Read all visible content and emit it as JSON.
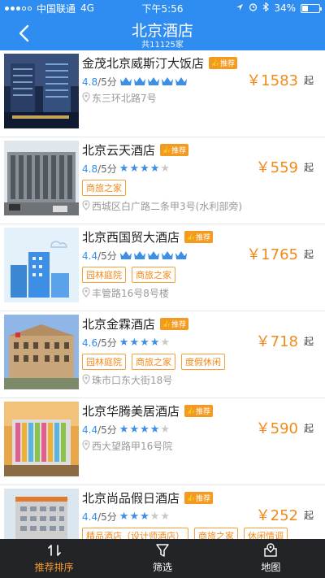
{
  "status": {
    "carrier": "中国联通",
    "network": "4G",
    "time": "下午5:56",
    "battery": "34%"
  },
  "header": {
    "title": "北京酒店",
    "subtitle": "共11125家"
  },
  "common": {
    "recommend_badge": "推荐",
    "score_unit": "/5分",
    "price_suffix": "起"
  },
  "hotels": [
    {
      "name": "金茂北京威斯汀大饭店",
      "score": "4.8",
      "stars": 5,
      "rating_type": "crown",
      "tags": [],
      "address": "东三环北路7号",
      "price": "￥1583"
    },
    {
      "name": "北京云天酒店",
      "score": "4.8",
      "stars": 4,
      "rating_type": "star",
      "tags": [
        "商旅之家"
      ],
      "address": "西城区白广路二条甲3号(水利部旁)",
      "price": "￥559"
    },
    {
      "name": "北京西国贸大酒店",
      "score": "4.4",
      "stars": 5,
      "rating_type": "crown",
      "tags": [
        "园林庭院",
        "商旅之家"
      ],
      "address": "丰管路16号8号楼",
      "price": "￥1765"
    },
    {
      "name": "北京金霖酒店",
      "score": "4.6",
      "stars": 4,
      "rating_type": "star",
      "tags": [
        "园林庭院",
        "商旅之家",
        "度假休闲"
      ],
      "address": "珠市口东大街18号",
      "price": "￥718"
    },
    {
      "name": "北京华腾美居酒店",
      "score": "4.4",
      "stars": 4,
      "rating_type": "star",
      "tags": [],
      "address": "西大望路甲16号院",
      "price": "￥590"
    },
    {
      "name": "北京尚品假日酒店",
      "score": "4.4",
      "stars": 3,
      "rating_type": "star",
      "tags": [
        "精品酒店（设计师酒店）",
        "商旅之家",
        "休闲情调"
      ],
      "address": "",
      "price": "￥252"
    }
  ],
  "tabbar": {
    "sort": "推荐排序",
    "filter": "筛选",
    "map": "地图"
  },
  "colors": {
    "primary": "#2f8cf0",
    "accent": "#f08a1a",
    "tabbar_bg": "#222427",
    "tab_active": "#f49b2d"
  }
}
